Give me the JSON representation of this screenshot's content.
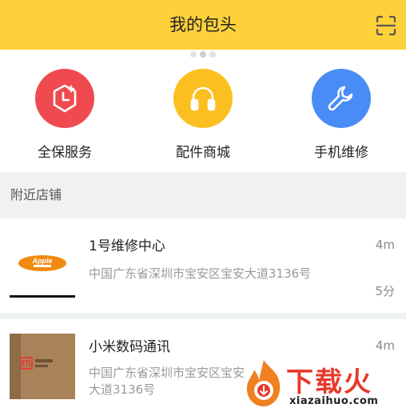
{
  "header": {
    "title": "我的包头",
    "scan_icon": "scan-icon"
  },
  "colors": {
    "header_bg": "#fdd13a",
    "warranty": "#ef4a4f",
    "parts": "#fbbf1f",
    "repair": "#4a8cf5"
  },
  "services": [
    {
      "label": "全保服务",
      "icon": "shield-clock-icon"
    },
    {
      "label": "配件商城",
      "icon": "headphones-icon"
    },
    {
      "label": "手机维修",
      "icon": "wrench-icon"
    }
  ],
  "nearby": {
    "title": "附近店铺"
  },
  "stores": [
    {
      "name": "1号维修中心",
      "distance": "4m",
      "address": "中国广东省深圳市宝安区宝安大道3136号",
      "time": "5分",
      "logo_text": "Apple"
    },
    {
      "name": "小米数码通讯",
      "distance": "4m",
      "address": "中国广东省深圳市宝安区宝安大道3136号"
    }
  ],
  "watermark": {
    "brand": "下载火",
    "url": "xiazaihuo.com"
  }
}
